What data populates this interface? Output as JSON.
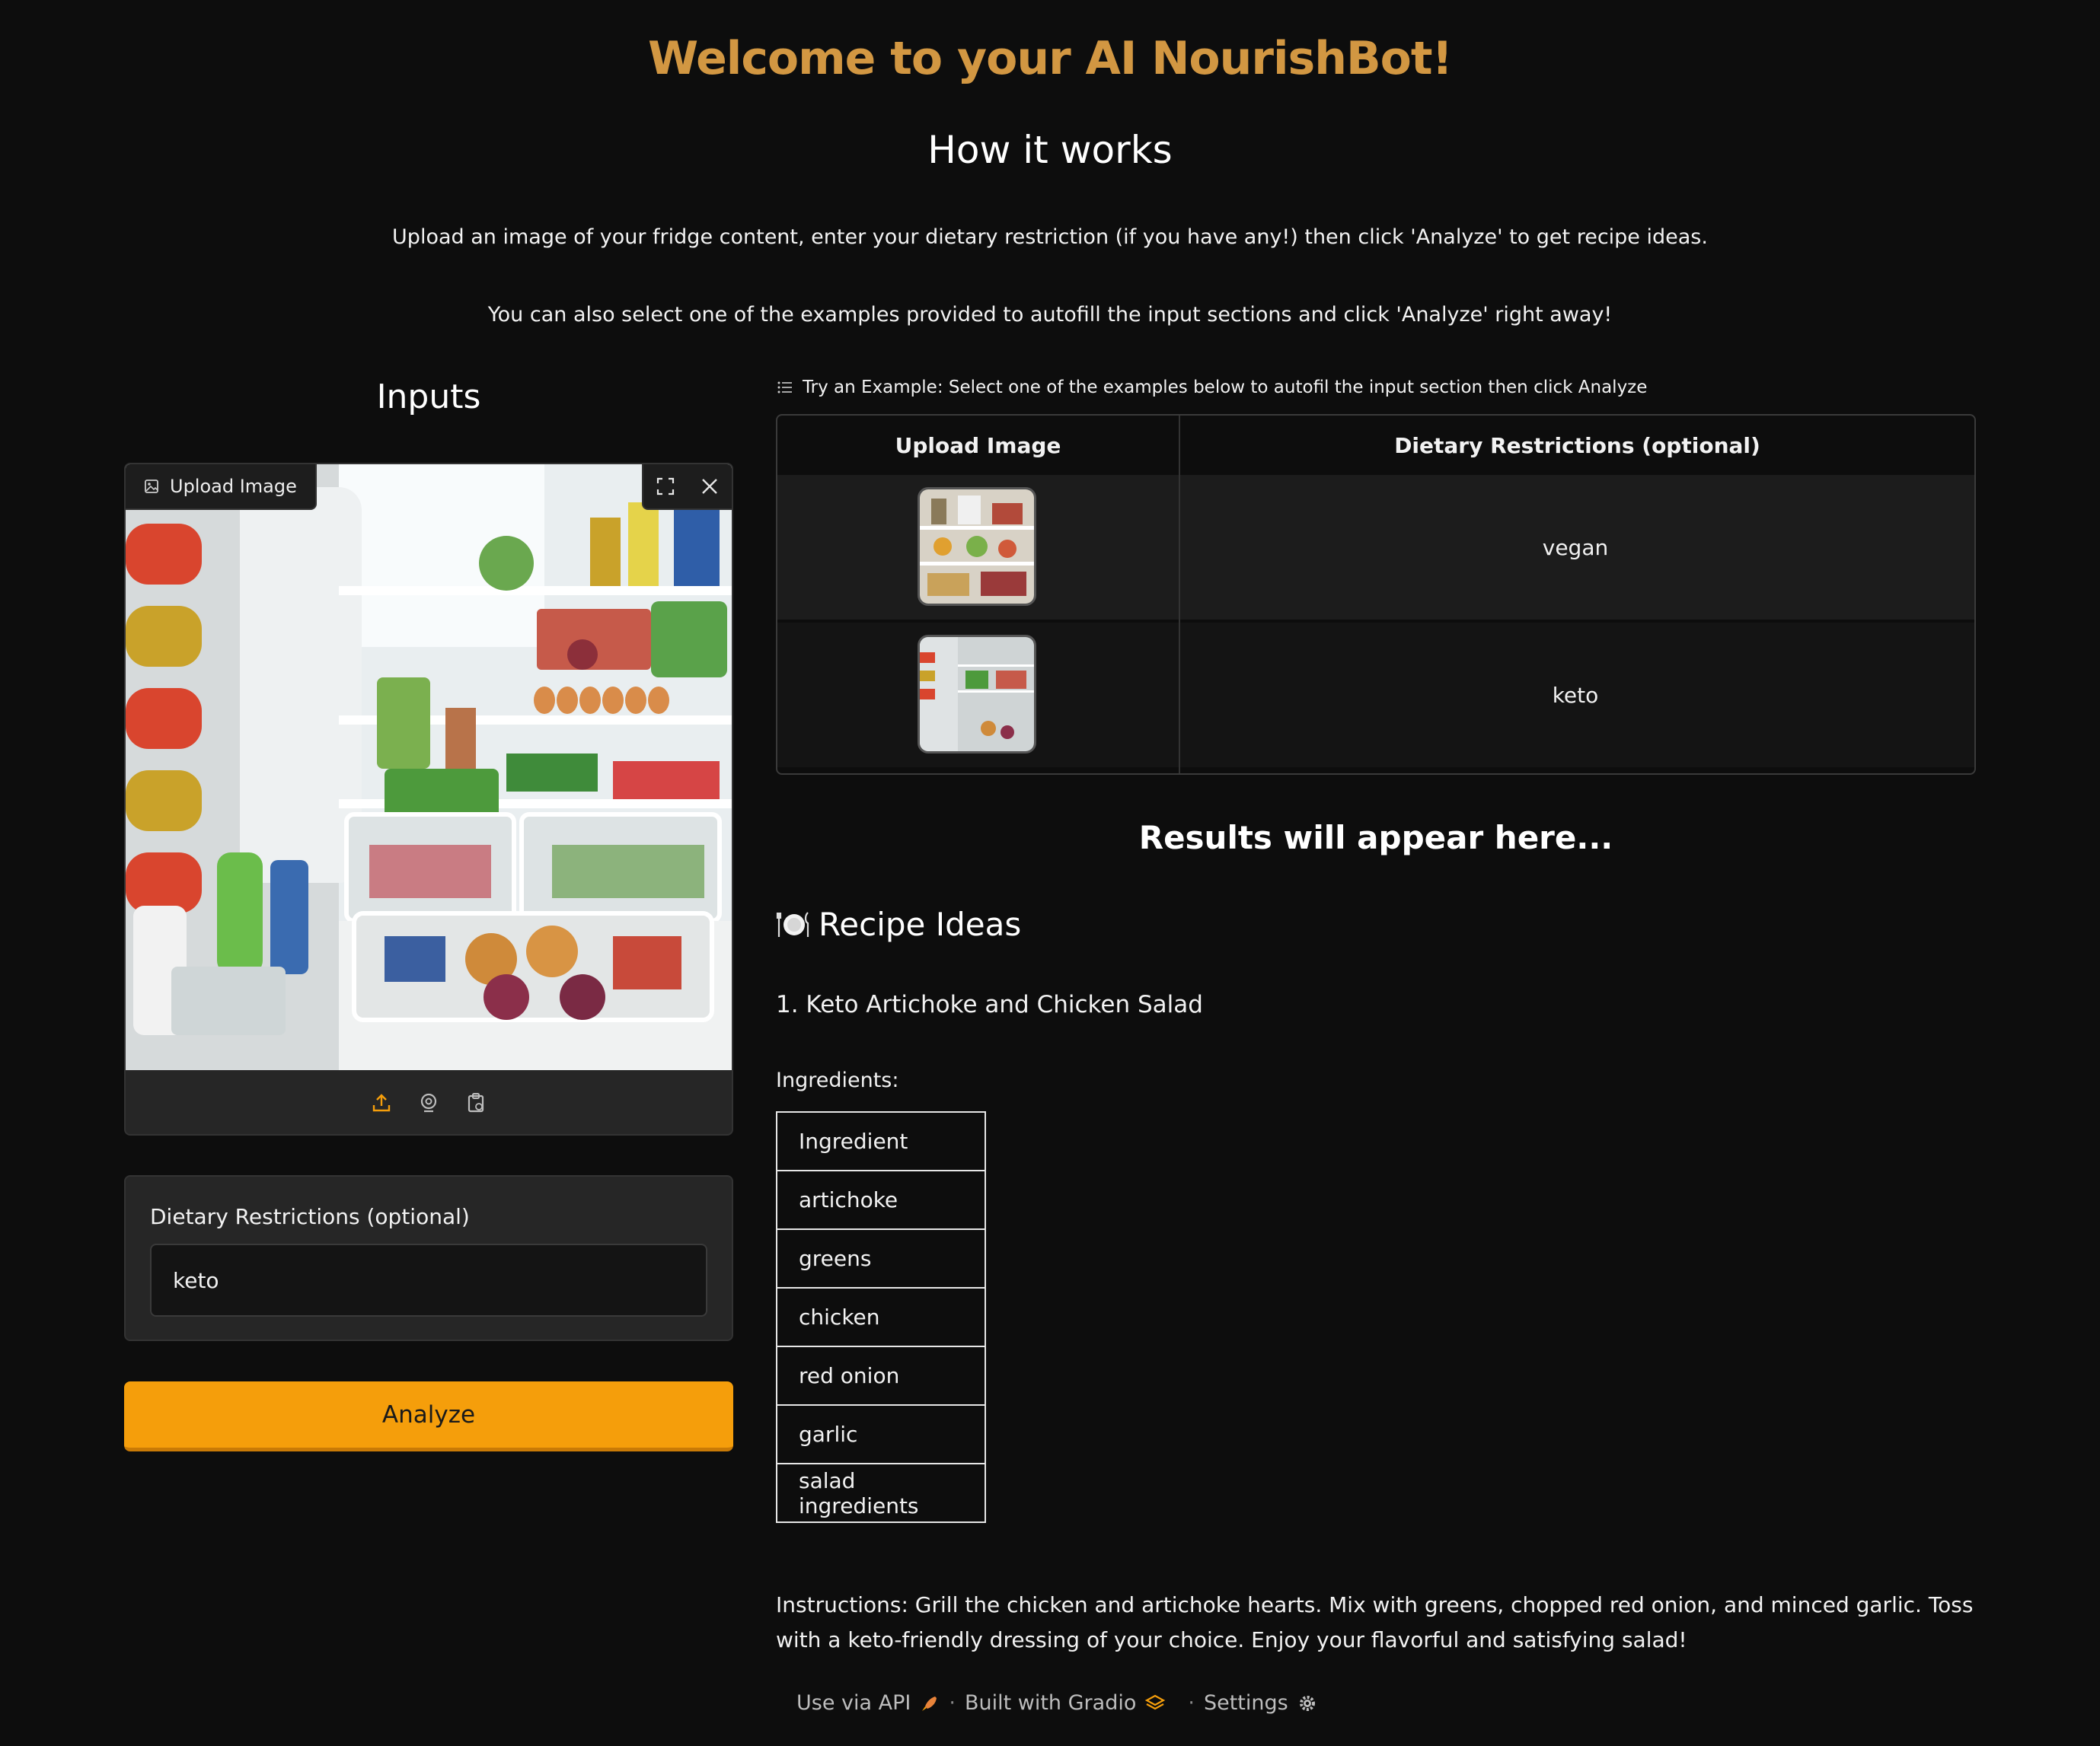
{
  "header": {
    "title": "Welcome to your AI NourishBot!",
    "how_title": "How it works",
    "paragraph_1": "Upload an image of your fridge content, enter your dietary restriction (if you have any!) then click 'Analyze' to get recipe ideas.",
    "paragraph_2": "You can also select one of the examples provided to autofill the input sections and click 'Analyze' right away!"
  },
  "inputs": {
    "heading": "Inputs",
    "image_label": "Upload Image",
    "dietary_label": "Dietary Restrictions (optional)",
    "dietary_value": "keto",
    "analyze_label": "Analyze"
  },
  "examples": {
    "label": "Try an Example: Select one of the examples below to autofil the input section then click Analyze",
    "col_image": "Upload Image",
    "col_diet": "Dietary Restrictions (optional)",
    "rows": [
      {
        "diet": "vegan"
      },
      {
        "diet": "keto"
      }
    ]
  },
  "results": {
    "placeholder": "Results will appear here...",
    "recipe_heading": "Recipe Ideas",
    "recipe_1_title": "1. Keto Artichoke and Chicken Salad",
    "ingredients_label": "Ingredients:",
    "ingredients": [
      "Ingredient",
      "artichoke",
      "greens",
      "chicken",
      "red onion",
      "garlic",
      "salad ingredients"
    ],
    "instructions_label": "Instructions:",
    "instructions_text": "Grill the chicken and artichoke hearts. Mix with greens, chopped red onion, and minced garlic. Toss with a keto-friendly dressing of your choice. Enjoy your flavorful and satisfying salad!"
  },
  "footer": {
    "api": "Use via API",
    "built": "Built with Gradio",
    "settings": "Settings"
  },
  "colors": {
    "background": "#0d0d0d",
    "title": "#d29742",
    "accent": "#f59e0b"
  }
}
